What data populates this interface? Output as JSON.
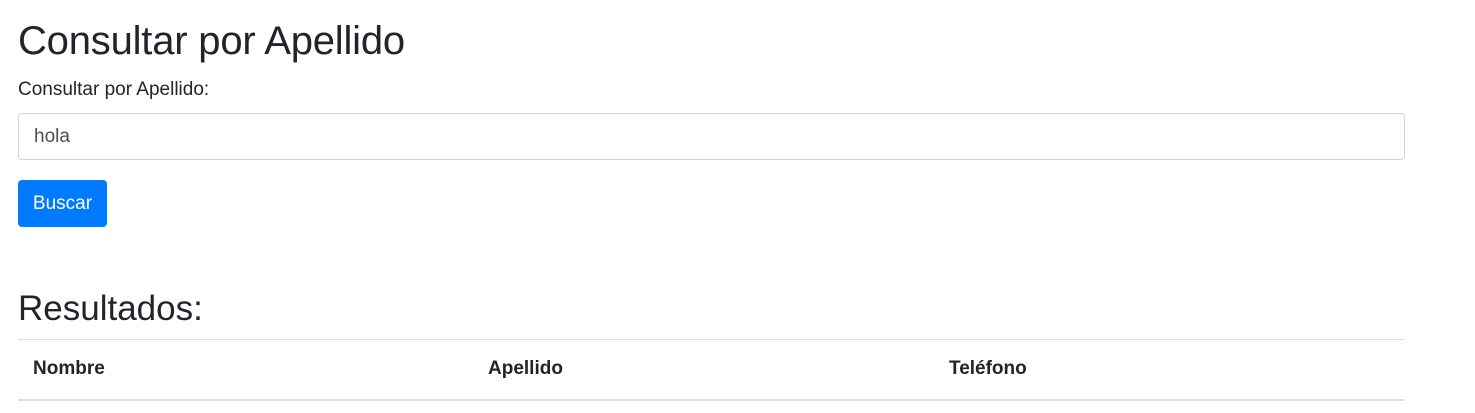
{
  "page": {
    "title": "Consultar por Apellido"
  },
  "search": {
    "label": "Consultar por Apellido:",
    "value": "hola",
    "button_label": "Buscar",
    "button_color": "#007bff"
  },
  "results": {
    "heading": "Resultados:",
    "columns": [
      "Nombre",
      "Apellido",
      "Teléfono"
    ],
    "rows": []
  }
}
